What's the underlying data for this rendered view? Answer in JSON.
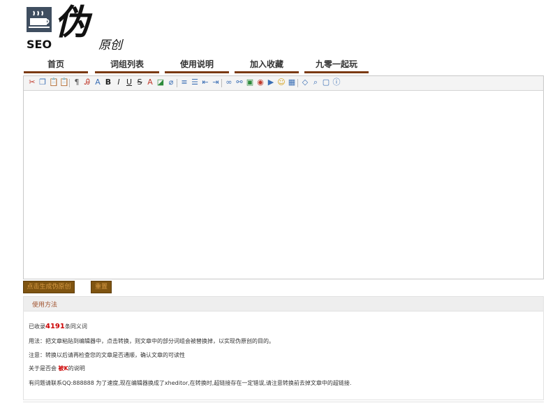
{
  "logo": {
    "seo_text": "SEO",
    "brush_text": "伪",
    "sub_text": "原创"
  },
  "nav": {
    "items": [
      {
        "label": "首页"
      },
      {
        "label": "词组列表"
      },
      {
        "label": "使用说明"
      },
      {
        "label": "加入收藏"
      },
      {
        "label": "九零一起玩"
      }
    ]
  },
  "toolbar": {
    "buttons": [
      {
        "icon": "cut-icon",
        "glyph": "✂",
        "color": "#c0392b"
      },
      {
        "icon": "copy-icon",
        "glyph": "❐",
        "color": "#3b6fb5"
      },
      {
        "icon": "paste-icon",
        "glyph": "📋",
        "color": "#a0763a"
      },
      {
        "icon": "paste-text-icon",
        "glyph": "📋",
        "color": "#a0763a"
      },
      {
        "icon": "block-format-icon",
        "glyph": "¶",
        "color": "#555"
      },
      {
        "icon": "font-family-icon",
        "glyph": "Ꭿ",
        "color": "#c0392b"
      },
      {
        "icon": "font-size-icon",
        "glyph": "A",
        "color": "#3b6fb5"
      },
      {
        "icon": "bold-icon",
        "glyph": "B",
        "color": "#222"
      },
      {
        "icon": "italic-icon",
        "glyph": "I",
        "color": "#222"
      },
      {
        "icon": "underline-icon",
        "glyph": "U",
        "color": "#222"
      },
      {
        "icon": "strikethrough-icon",
        "glyph": "S",
        "color": "#222"
      },
      {
        "icon": "font-color-icon",
        "glyph": "A",
        "color": "#c0392b"
      },
      {
        "icon": "background-color-icon",
        "glyph": "◪",
        "color": "#2c8a3a"
      },
      {
        "icon": "remove-format-icon",
        "glyph": "⌀",
        "color": "#3b6fb5"
      },
      {
        "icon": "align-icon",
        "glyph": "≡",
        "color": "#3b6fb5"
      },
      {
        "icon": "list-icon",
        "glyph": "☰",
        "color": "#3b6fb5"
      },
      {
        "icon": "outdent-icon",
        "glyph": "⇤",
        "color": "#3b6fb5"
      },
      {
        "icon": "indent-icon",
        "glyph": "⇥",
        "color": "#3b6fb5"
      },
      {
        "icon": "link-icon",
        "glyph": "∞",
        "color": "#3b6fb5"
      },
      {
        "icon": "unlink-icon",
        "glyph": "⚯",
        "color": "#3b6fb5"
      },
      {
        "icon": "image-icon",
        "glyph": "▣",
        "color": "#2c8a3a"
      },
      {
        "icon": "flash-icon",
        "glyph": "◉",
        "color": "#c0392b"
      },
      {
        "icon": "media-icon",
        "glyph": "▶",
        "color": "#3b6fb5"
      },
      {
        "icon": "emotion-icon",
        "glyph": "☺",
        "color": "#d4a017"
      },
      {
        "icon": "table-icon",
        "glyph": "▦",
        "color": "#3b6fb5"
      },
      {
        "icon": "source-icon",
        "glyph": "◇",
        "color": "#3b6fb5"
      },
      {
        "icon": "preview-icon",
        "glyph": "⌕",
        "color": "#3b6fb5"
      },
      {
        "icon": "fullscreen-icon",
        "glyph": "▢",
        "color": "#3b6fb5"
      },
      {
        "icon": "about-icon",
        "glyph": "ⓘ",
        "color": "#3b6fb5"
      }
    ]
  },
  "buttons": {
    "generate_label": "点击生成伪原创",
    "reset_label": "重置"
  },
  "usage": {
    "title": "使用方法",
    "line1_prefix": "已收录",
    "line1_count": "4191",
    "line1_suffix": "条同义词",
    "line2": "用法：把文章粘贴到编辑器中，点击转换，则文章中的部分词组会被替换掉，以实现伪原创的目的。",
    "line3": "注意：转换以后请再检查您的文章是否通顺，确认文章的可读性",
    "line4_prefix": "关于是否会",
    "line4_bad": "被K",
    "line4_suffix": "的说明",
    "line5": "有问题请联系QQ:888888 为了速度,现在编辑器换成了xheditor,在转换时,超链接存在一定错误,请注意转换前去掉文章中的超链接."
  },
  "colors": {
    "nav_underline": "#7b3a12",
    "button_bg": "#7f5411",
    "button_text": "#d89a43",
    "count_red": "#cc0000"
  }
}
